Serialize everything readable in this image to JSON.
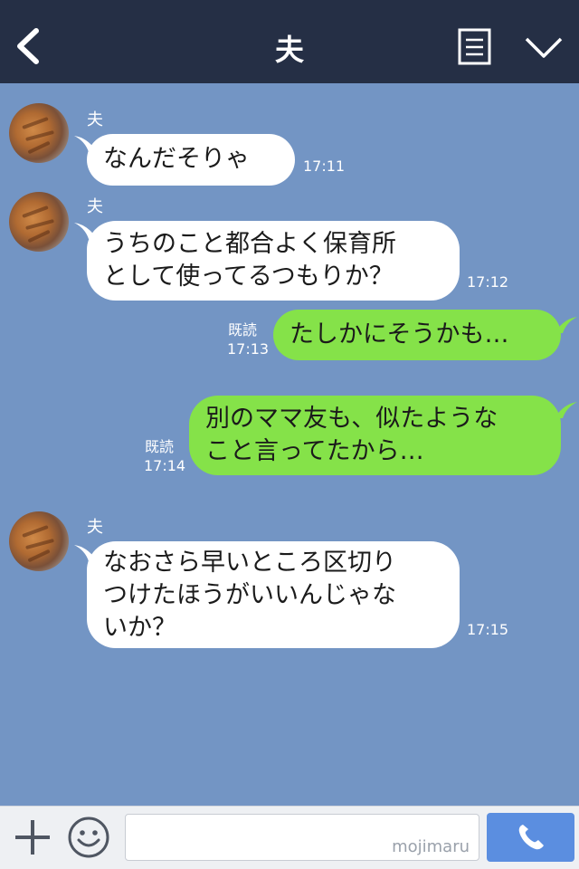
{
  "header": {
    "title": "夫"
  },
  "messages": [
    {
      "sender": "夫",
      "text": "なんだそりゃ",
      "time": "17:11"
    },
    {
      "sender": "夫",
      "lines": [
        "うちのこと都合よく保育所",
        "として使ってるつもりか？"
      ],
      "time": "17:12"
    },
    {
      "text": "たしかにそうかも…",
      "read": "既読",
      "time": "17:13"
    },
    {
      "lines": [
        "別のママ友も、似たような",
        "こと言ってたから…"
      ],
      "read": "既読",
      "time": "17:14"
    },
    {
      "sender": "夫",
      "lines": [
        "なおさら早いところ区切り",
        "つけたほうがいいんじゃな",
        "いか？"
      ],
      "time": "17:15"
    }
  ],
  "inputbar": {
    "watermark": "mojimaru"
  },
  "colors": {
    "header": "#252f45",
    "background": "#7395c4",
    "outgoing_bubble": "#85e249",
    "incoming_bubble": "#ffffff",
    "call_button": "#5b8ee0"
  },
  "icons": [
    "back-icon",
    "menu-icon",
    "dropdown-icon",
    "plus-icon",
    "emoji-icon",
    "phone-icon"
  ]
}
